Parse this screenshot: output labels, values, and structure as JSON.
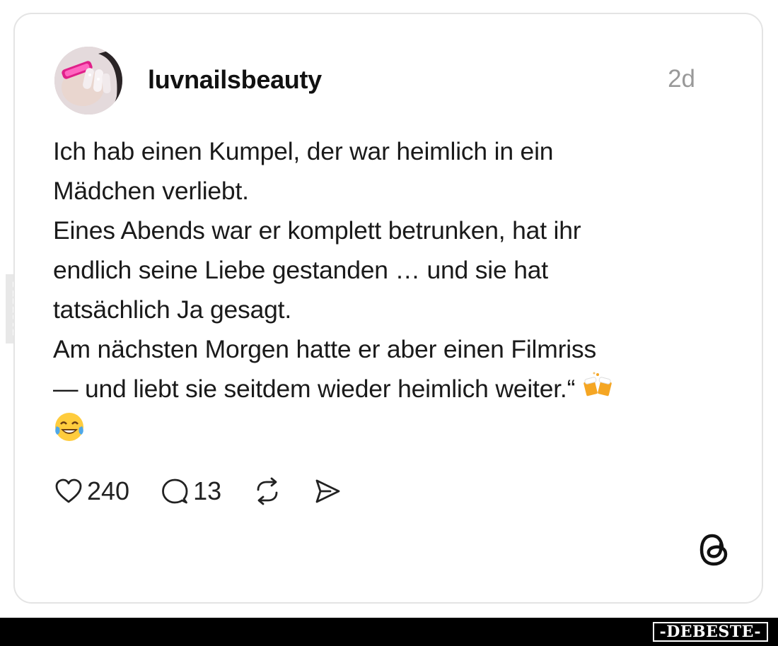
{
  "post": {
    "username": "luvnailsbeauty",
    "time": "2d",
    "lines": [
      "Ich hab einen Kumpel, der war heimlich in ein",
      "Mädchen verliebt.",
      "Eines Abends war er komplett betrunken, hat ihr",
      "endlich seine Liebe gestanden … und sie hat",
      "tatsächlich Ja gesagt.",
      "Am nächsten Morgen hatte er aber einen Filmriss",
      "— und liebt sie seitdem wieder heimlich weiter.“"
    ],
    "emojis": [
      "beer-mugs-emoji",
      "tears-of-joy-emoji"
    ]
  },
  "actions": {
    "likes": "240",
    "comments": "13"
  },
  "icons": {
    "like": "heart-icon",
    "comment": "comment-bubble-icon",
    "repost": "repost-icon",
    "share": "send-icon",
    "brand": "threads-logo-icon"
  },
  "watermark": {
    "side": "DEBESTE",
    "footer": "-DEBESTE-"
  },
  "colors": {
    "text": "#1a1a1a",
    "muted": "#999999",
    "border": "#e4e4e4",
    "footer": "#000000"
  }
}
